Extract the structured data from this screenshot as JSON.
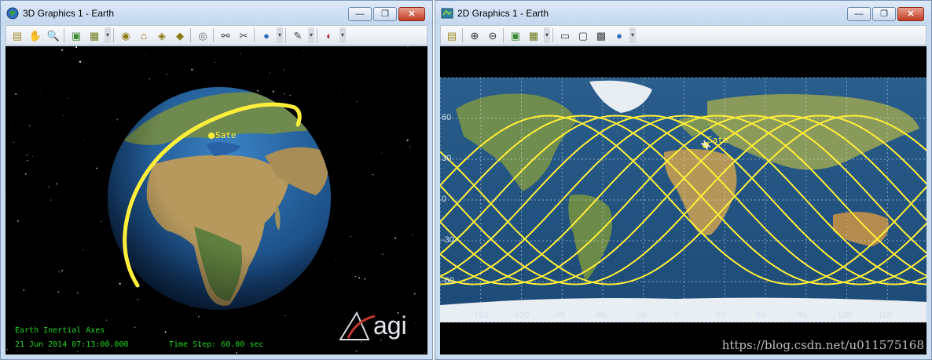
{
  "window3d": {
    "title": "3D Graphics 1 - Earth",
    "hud": {
      "axes": "Earth Inertial Axes",
      "datetime": "21 Jun 2014 07:13:00.000",
      "timestep": "Time Step: 60.00 sec"
    },
    "satellite_label": "Sate",
    "logo_text": "agi",
    "toolbar_icons": [
      "properties-icon",
      "pan-hand-icon",
      "zoom-icon",
      "sep",
      "view-icon",
      "snapshot-icon",
      "dropdown",
      "sep",
      "orbit-view-icon",
      "home-view-icon",
      "view-from-icon",
      "view-to-icon",
      "sep",
      "camera-icon",
      "sep",
      "link-icon",
      "unlink-icon",
      "sep",
      "globe-icon",
      "dropdown",
      "sep",
      "tool-icon",
      "dropdown",
      "sep",
      "record-icon",
      "dropdown"
    ]
  },
  "window2d": {
    "title": "2D Graphics 1 - Earth",
    "satellite_label": "Sate",
    "lat_ticks": [
      "60",
      "30",
      "0",
      "-30",
      "-60"
    ],
    "lon_ticks": [
      "-150",
      "-120",
      "-90",
      "-60",
      "-30",
      "0",
      "30",
      "60",
      "90",
      "120",
      "150"
    ],
    "toolbar_icons": [
      "properties-icon",
      "sep",
      "zoom-in-icon",
      "zoom-out-icon",
      "sep",
      "view-icon",
      "snapshot-icon",
      "dropdown",
      "sep",
      "ruler-icon",
      "aspect-ratio-icon",
      "grid-icon",
      "globe-icon",
      "dropdown"
    ]
  },
  "window_buttons": {
    "minimize": "—",
    "restore": "❐",
    "close": "✕"
  },
  "watermark": "https://blog.csdn.net/u011575168",
  "colors": {
    "track": "#ffef3a",
    "hud": "#1fd81f"
  }
}
